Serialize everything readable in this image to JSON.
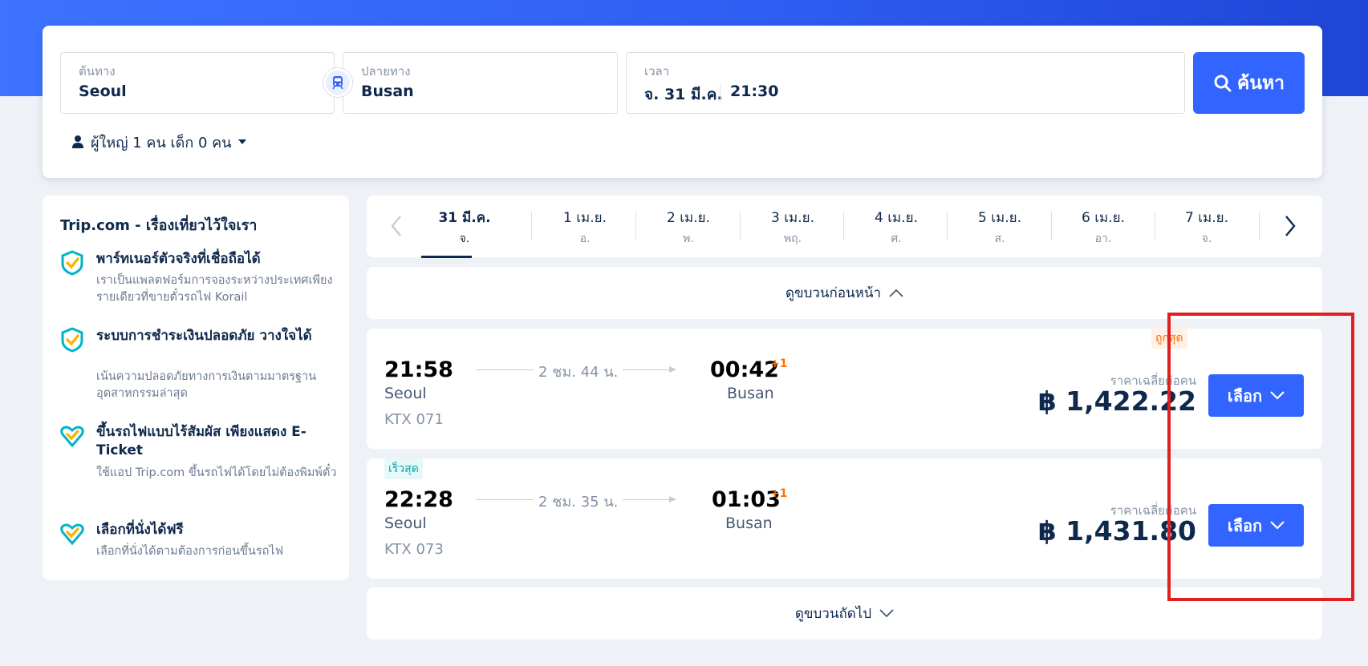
{
  "search": {
    "origin_label": "ต้นทาง",
    "origin_value": "Seoul",
    "destination_label": "ปลายทาง",
    "destination_value": "Busan",
    "time_label": "เวลา",
    "date_value": "จ. 31 มี.ค.",
    "time_value": "21:30",
    "search_button": "ค้นหา",
    "passengers": "ผู้ใหญ่ 1 คน เด็ก 0 คน"
  },
  "sidebar": {
    "title": "Trip.com - เรื่องเที่ยวไว้ใจเรา",
    "features": [
      {
        "title": "พาร์ทเนอร์ตัวจริงที่เชื่อถือได้",
        "desc": "เราเป็นแพลตฟอร์มการจองระหว่างประเทศเพียงรายเดียวที่ขายตั๋วรถไฟ Korail"
      },
      {
        "title": "ระบบการชำระเงินปลอดภัย วางใจได้",
        "desc": "เน้นความปลอดภัยทางการเงินตามมาตรฐานอุตสาหกรรมล่าสุด"
      },
      {
        "title": "ขึ้นรถไฟแบบไร้สัมผัส เพียงแสดง E-Ticket",
        "desc": "ใช้แอป Trip.com ขึ้นรถไฟได้โดยไม่ต้องพิมพ์ตั๋ว"
      },
      {
        "title": "เลือกที่นั่งได้ฟรี",
        "desc": "เลือกที่นั่งได้ตามต้องการก่อนขึ้นรถไฟ"
      }
    ]
  },
  "dates": [
    {
      "date": "31 มี.ค.",
      "day": "จ."
    },
    {
      "date": "1 เม.ย.",
      "day": "อ."
    },
    {
      "date": "2 เม.ย.",
      "day": "พ."
    },
    {
      "date": "3 เม.ย.",
      "day": "พฤ."
    },
    {
      "date": "4 เม.ย.",
      "day": "ศ."
    },
    {
      "date": "5 เม.ย.",
      "day": "ส."
    },
    {
      "date": "6 เม.ย.",
      "day": "อา."
    },
    {
      "date": "7 เม.ย.",
      "day": "จ."
    }
  ],
  "earlier_label": "ดูขบวนก่อนหน้า",
  "later_label": "ดูขบวนถัดไป",
  "trains": [
    {
      "badge": "ถูกสุด",
      "dep_time": "21:58",
      "dep_city": "Seoul",
      "duration": "2 ชม. 44 น.",
      "arr_time": "00:42",
      "arr_plus": "+1",
      "arr_city": "Busan",
      "train_no": "KTX 071",
      "price_note": "ราคาเฉลี่ยต่อคน",
      "price": "฿ 1,422.22",
      "select_label": "เลือก"
    },
    {
      "badge": "เร็วสุด",
      "dep_time": "22:28",
      "dep_city": "Seoul",
      "duration": "2 ชม. 35 น.",
      "arr_time": "01:03",
      "arr_plus": "+1",
      "arr_city": "Busan",
      "train_no": "KTX 073",
      "price_note": "ราคาเฉลี่ยต่อคน",
      "price": "฿ 1,431.80",
      "select_label": "เลือก"
    }
  ],
  "colors": {
    "primary": "#3264ff",
    "cheap": "#ff6f00",
    "fast": "#00a8a8",
    "highlight": "#e02020"
  }
}
